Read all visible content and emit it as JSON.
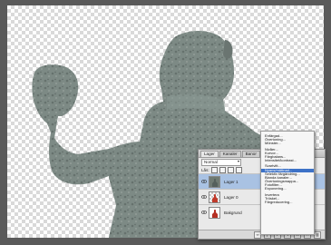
{
  "colors": {
    "stone": "#7d8a85",
    "selection": "#3d72c7",
    "layer_selected": "#a9c2e3",
    "app_frame": "#5a5a5a"
  },
  "layers_panel": {
    "tabs": [
      {
        "label": "Lager"
      },
      {
        "label": "Kanaler"
      },
      {
        "label": "Banor"
      }
    ],
    "blend_mode": "Normal",
    "lock_label": "Lås:",
    "layers": [
      {
        "name": "Lager 1",
        "selected": true,
        "icon": "stone-figure-thumb"
      },
      {
        "name": "Lager 0",
        "selected": false,
        "icon": "mask-thumb"
      },
      {
        "name": "Bakgrund",
        "selected": false,
        "icon": "background-thumb"
      }
    ],
    "footer_icons": [
      "link-icon",
      "fx-icon",
      "mask-icon",
      "adjustment-icon",
      "folder-icon",
      "new-layer-icon",
      "trash-icon"
    ]
  },
  "context_menu": {
    "items": [
      {
        "label": "Enfärgad...",
        "group": 1
      },
      {
        "label": "Övertoning...",
        "group": 1
      },
      {
        "label": "Mönster...",
        "group": 1
      },
      {
        "label": "Nivåer...",
        "group": 2
      },
      {
        "label": "Kurvor...",
        "group": 2
      },
      {
        "label": "Färgbalans...",
        "group": 2
      },
      {
        "label": "Intensitet/kontrast...",
        "group": 2
      },
      {
        "label": "Svartvitt...",
        "group": 3
      },
      {
        "label": "Nyans/mättnad...",
        "group": 3,
        "active": true
      },
      {
        "label": "Selektiv färgändring...",
        "group": 3
      },
      {
        "label": "Blanda kanaler...",
        "group": 3
      },
      {
        "label": "Övertoningsmappa...",
        "group": 3
      },
      {
        "label": "Fotofilter...",
        "group": 3
      },
      {
        "label": "Exponering...",
        "group": 3
      },
      {
        "label": "Invertera",
        "group": 4
      },
      {
        "label": "Tröskel...",
        "group": 4
      },
      {
        "label": "Färgreducering...",
        "group": 4
      }
    ]
  }
}
